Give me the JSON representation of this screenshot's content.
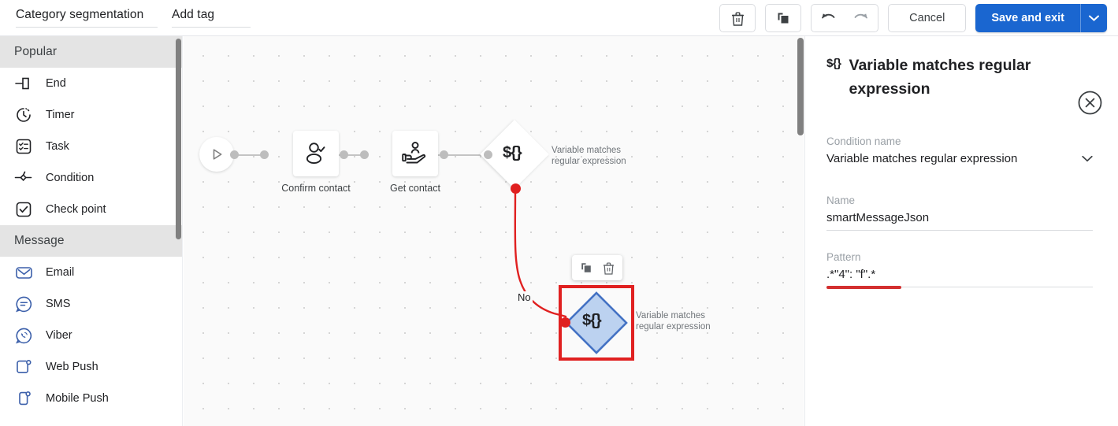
{
  "topbar": {
    "workflow_name": "Category segmentation",
    "add_tag": "Add tag",
    "delete_icon": "trash-icon",
    "duplicate_icon": "copy-icon",
    "undo_icon": "undo-arrow-icon",
    "redo_icon": "redo-arrow-icon",
    "cancel_label": "Cancel",
    "save_label": "Save and exit",
    "save_caret_icon": "chevron-down-icon",
    "accent_color": "#1a66d0"
  },
  "sidebar": {
    "sections": [
      {
        "title": "Popular",
        "items": [
          {
            "label": "End",
            "icon": "end-icon"
          },
          {
            "label": "Timer",
            "icon": "timer-icon"
          },
          {
            "label": "Task",
            "icon": "task-icon"
          },
          {
            "label": "Condition",
            "icon": "condition-icon"
          },
          {
            "label": "Check point",
            "icon": "check-point-icon"
          }
        ]
      },
      {
        "title": "Message",
        "items": [
          {
            "label": "Email",
            "icon": "email-icon"
          },
          {
            "label": "SMS",
            "icon": "sms-icon"
          },
          {
            "label": "Viber",
            "icon": "viber-icon"
          },
          {
            "label": "Web Push",
            "icon": "web-push-icon"
          },
          {
            "label": "Mobile Push",
            "icon": "mobile-push-icon"
          }
        ]
      }
    ]
  },
  "canvas": {
    "nodes": [
      {
        "id": "start",
        "type": "start",
        "label": "",
        "icon": "play-icon"
      },
      {
        "id": "confirm-contact",
        "type": "box",
        "label": "Confirm contact",
        "icon": "user-check-icon"
      },
      {
        "id": "get-contact",
        "type": "box",
        "label": "Get contact",
        "icon": "hand-user-icon"
      },
      {
        "id": "condition-1",
        "type": "diamond",
        "glyph": "${}",
        "label": "Variable matches regular expression",
        "selected": false
      },
      {
        "id": "condition-2",
        "type": "diamond",
        "glyph": "${}",
        "label": "Variable matches regular expression",
        "selected": true
      }
    ],
    "edge_labels": [
      "No"
    ],
    "mini_toolbar": {
      "duplicate_icon": "copy-icon",
      "delete_icon": "trash-icon"
    },
    "error_color": "#e02020",
    "selected_fill": "#bcd2f0",
    "selected_stroke": "#4472c4"
  },
  "right_panel": {
    "glyph": "${}",
    "title": "Variable matches regular expression",
    "close_icon": "close-circle-icon",
    "fields": [
      {
        "key": "condition_name",
        "label": "Condition name",
        "value": "Variable matches regular expression",
        "type": "select",
        "caret_icon": "chevron-down-icon"
      },
      {
        "key": "name",
        "label": "Name",
        "value": "smartMessageJson",
        "type": "text"
      },
      {
        "key": "pattern",
        "label": "Pattern",
        "value": ".*\"4\": \"f\".*",
        "type": "text",
        "error": true
      }
    ]
  }
}
